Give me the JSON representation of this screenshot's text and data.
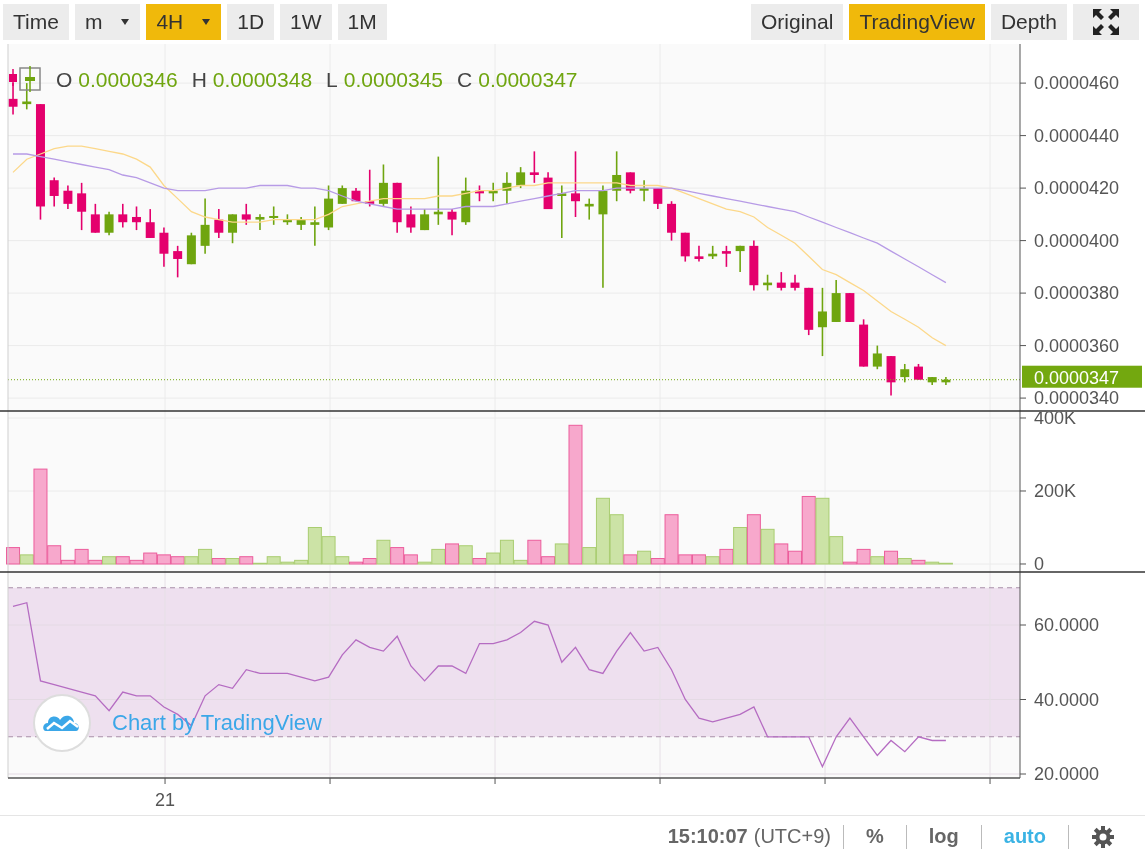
{
  "toolbar": {
    "label": "Time",
    "intervals": [
      {
        "label": "m",
        "dropdown": true,
        "selected": false
      },
      {
        "label": "4H",
        "dropdown": true,
        "selected": true
      },
      {
        "label": "1D",
        "dropdown": false,
        "selected": false
      },
      {
        "label": "1W",
        "dropdown": false,
        "selected": false
      },
      {
        "label": "1M",
        "dropdown": false,
        "selected": false
      }
    ],
    "views": [
      {
        "label": "Original",
        "selected": false
      },
      {
        "label": "TradingView",
        "selected": true
      },
      {
        "label": "Depth",
        "selected": false
      }
    ]
  },
  "price_pane": {
    "legend": [
      {
        "label": "O",
        "value": "0.0000346"
      },
      {
        "label": "H",
        "value": "0.0000348"
      },
      {
        "label": "L",
        "value": "0.0000345"
      },
      {
        "label": "C",
        "value": "0.0000347"
      }
    ],
    "chart_data": {
      "type": "candlestick",
      "grid": true,
      "categories": [
        null,
        null,
        null,
        null,
        null,
        null,
        null,
        null,
        null,
        null,
        null,
        null,
        null,
        null,
        null,
        null,
        null,
        null,
        null,
        null,
        null,
        null,
        null,
        null,
        null,
        null,
        null,
        null,
        null,
        null,
        null,
        null,
        null,
        null,
        null,
        null,
        null,
        null,
        null,
        null,
        null,
        null,
        null,
        null,
        null,
        null,
        null,
        null,
        null,
        null,
        null,
        null,
        null,
        null,
        null,
        null,
        null,
        null,
        null,
        null,
        null,
        null,
        null,
        null,
        null,
        null,
        null,
        null,
        null
      ],
      "ylim": [
        3.347e-05,
        4.749e-05
      ],
      "yticks": [
        {
          "value": 3.4e-05,
          "label": "0.0000340"
        },
        {
          "value": 3.6e-05,
          "label": "0.0000360"
        },
        {
          "value": 3.8e-05,
          "label": "0.0000380"
        },
        {
          "value": 4e-05,
          "label": "0.0000400"
        },
        {
          "value": 4.2e-05,
          "label": "0.0000420"
        },
        {
          "value": 4.4e-05,
          "label": "0.0000440"
        },
        {
          "value": 4.6e-05,
          "label": "0.0000460"
        }
      ],
      "ohlc": [
        [
          4.54e-05,
          4.6e-05,
          4.48e-05,
          4.51e-05
        ],
        [
          4.52e-05,
          4.6e-05,
          4.5e-05,
          4.53e-05
        ],
        [
          4.52e-05,
          4.52e-05,
          4.08e-05,
          4.13e-05
        ],
        [
          4.23e-05,
          4.24e-05,
          4.13e-05,
          4.17e-05
        ],
        [
          4.19e-05,
          4.21e-05,
          4.12e-05,
          4.14e-05
        ],
        [
          4.18e-05,
          4.22e-05,
          4.04e-05,
          4.11e-05
        ],
        [
          4.1e-05,
          4.14e-05,
          4.03e-05,
          4.03e-05
        ],
        [
          4.03e-05,
          4.11e-05,
          4.02e-05,
          4.1e-05
        ],
        [
          4.1e-05,
          4.14e-05,
          4.05e-05,
          4.07e-05
        ],
        [
          4.09e-05,
          4.13e-05,
          4.04e-05,
          4.07e-05
        ],
        [
          4.07e-05,
          4.12e-05,
          4.01e-05,
          4.01e-05
        ],
        [
          4.03e-05,
          4.05e-05,
          3.9e-05,
          3.95e-05
        ],
        [
          3.96e-05,
          3.98e-05,
          3.86e-05,
          3.93e-05
        ],
        [
          3.91e-05,
          4.03e-05,
          3.91e-05,
          4.02e-05
        ],
        [
          3.98e-05,
          4.16e-05,
          3.95e-05,
          4.06e-05
        ],
        [
          4.08e-05,
          4.12e-05,
          4.01e-05,
          4.03e-05
        ],
        [
          4.03e-05,
          4.1e-05,
          3.99e-05,
          4.1e-05
        ],
        [
          4.1e-05,
          4.14e-05,
          4.06e-05,
          4.08e-05
        ],
        [
          4.08e-05,
          4.1e-05,
          4.04e-05,
          4.09e-05
        ],
        [
          4.09e-05,
          4.13e-05,
          4.06e-05,
          4.09e-05
        ],
        [
          4.07e-05,
          4.1e-05,
          4.06e-05,
          4.08e-05
        ],
        [
          4.06e-05,
          4.09e-05,
          4.04e-05,
          4.08e-05
        ],
        [
          4.06e-05,
          4.13e-05,
          3.98e-05,
          4.07e-05
        ],
        [
          4.05e-05,
          4.21e-05,
          4.04e-05,
          4.16e-05
        ],
        [
          4.14e-05,
          4.21e-05,
          4.14e-05,
          4.2e-05
        ],
        [
          4.19e-05,
          4.2e-05,
          4.15e-05,
          4.15e-05
        ],
        [
          4.15e-05,
          4.27e-05,
          4.13e-05,
          4.14e-05
        ],
        [
          4.14e-05,
          4.29e-05,
          4.13e-05,
          4.22e-05
        ],
        [
          4.22e-05,
          4.22e-05,
          4.03e-05,
          4.07e-05
        ],
        [
          4.1e-05,
          4.13e-05,
          4.03e-05,
          4.05e-05
        ],
        [
          4.04e-05,
          4.12e-05,
          4.04e-05,
          4.1e-05
        ],
        [
          4.1e-05,
          4.32e-05,
          4.06e-05,
          4.11e-05
        ],
        [
          4.11e-05,
          4.12e-05,
          4.02e-05,
          4.08e-05
        ],
        [
          4.07e-05,
          4.24e-05,
          4.06e-05,
          4.19e-05
        ],
        [
          4.19e-05,
          4.21e-05,
          4.15e-05,
          4.18e-05
        ],
        [
          4.18e-05,
          4.22e-05,
          4.15e-05,
          4.19e-05
        ],
        [
          4.19e-05,
          4.26e-05,
          4.14e-05,
          4.22e-05
        ],
        [
          4.21e-05,
          4.28e-05,
          4.2e-05,
          4.26e-05
        ],
        [
          4.26e-05,
          4.34e-05,
          4.22e-05,
          4.25e-05
        ],
        [
          4.24e-05,
          4.26e-05,
          4.12e-05,
          4.12e-05
        ],
        [
          4.17e-05,
          4.21e-05,
          4.01e-05,
          4.18e-05
        ],
        [
          4.18e-05,
          4.34e-05,
          4.09e-05,
          4.15e-05
        ],
        [
          4.13e-05,
          4.16e-05,
          4.08e-05,
          4.14e-05
        ],
        [
          4.1e-05,
          4.21e-05,
          3.82e-05,
          4.19e-05
        ],
        [
          4.19e-05,
          4.34e-05,
          4.15e-05,
          4.25e-05
        ],
        [
          4.26e-05,
          4.26e-05,
          4.18e-05,
          4.19e-05
        ],
        [
          4.19e-05,
          4.23e-05,
          4.15e-05,
          4.2e-05
        ],
        [
          4.2e-05,
          4.2e-05,
          4.12e-05,
          4.14e-05
        ],
        [
          4.14e-05,
          4.15e-05,
          4e-05,
          4.03e-05
        ],
        [
          4.03e-05,
          4.03e-05,
          3.92e-05,
          3.94e-05
        ],
        [
          3.94e-05,
          3.98e-05,
          3.92e-05,
          3.93e-05
        ],
        [
          3.94e-05,
          3.98e-05,
          3.93e-05,
          3.95e-05
        ],
        [
          3.96e-05,
          3.98e-05,
          3.9e-05,
          3.95e-05
        ],
        [
          3.96e-05,
          3.98e-05,
          3.88e-05,
          3.98e-05
        ],
        [
          3.98e-05,
          4e-05,
          3.81e-05,
          3.83e-05
        ],
        [
          3.83e-05,
          3.87e-05,
          3.81e-05,
          3.84e-05
        ],
        [
          3.84e-05,
          3.88e-05,
          3.81e-05,
          3.82e-05
        ],
        [
          3.84e-05,
          3.87e-05,
          3.81e-05,
          3.82e-05
        ],
        [
          3.82e-05,
          3.82e-05,
          3.64e-05,
          3.66e-05
        ],
        [
          3.67e-05,
          3.82e-05,
          3.56e-05,
          3.73e-05
        ],
        [
          3.69e-05,
          3.85e-05,
          3.69e-05,
          3.8e-05
        ],
        [
          3.8e-05,
          3.8e-05,
          3.69e-05,
          3.69e-05
        ],
        [
          3.68e-05,
          3.7e-05,
          3.52e-05,
          3.52e-05
        ],
        [
          3.52e-05,
          3.6e-05,
          3.51e-05,
          3.57e-05
        ],
        [
          3.56e-05,
          3.56e-05,
          3.41e-05,
          3.46e-05
        ],
        [
          3.48e-05,
          3.53e-05,
          3.46e-05,
          3.51e-05
        ],
        [
          3.52e-05,
          3.53e-05,
          3.47e-05,
          3.47e-05
        ],
        [
          3.46e-05,
          3.48e-05,
          3.45e-05,
          3.48e-05
        ],
        [
          3.46e-05,
          3.48e-05,
          3.45e-05,
          3.47e-05
        ]
      ],
      "series": [
        {
          "type": "line",
          "color": "#fcd88a",
          "values": [
            4.26e-05,
            4.31e-05,
            4.33e-05,
            4.35e-05,
            4.36e-05,
            4.36e-05,
            4.35e-05,
            4.34e-05,
            4.33e-05,
            4.31e-05,
            4.28e-05,
            4.21e-05,
            4.16e-05,
            4.11e-05,
            4.09e-05,
            4.08e-05,
            4.07e-05,
            4.07e-05,
            4.07e-05,
            4.08e-05,
            4.08e-05,
            4.08e-05,
            4.08e-05,
            4.1e-05,
            4.13e-05,
            4.14e-05,
            4.15e-05,
            4.16e-05,
            4.16e-05,
            4.16e-05,
            4.16e-05,
            4.17e-05,
            4.17e-05,
            4.18e-05,
            4.19e-05,
            4.19e-05,
            4.2e-05,
            4.21e-05,
            4.21e-05,
            4.22e-05,
            4.22e-05,
            4.22e-05,
            4.22e-05,
            4.22e-05,
            4.22e-05,
            4.21e-05,
            4.21e-05,
            4.21e-05,
            4.2e-05,
            4.18e-05,
            4.16e-05,
            4.14e-05,
            4.12e-05,
            4.11e-05,
            4.09e-05,
            4.05e-05,
            4.02e-05,
            3.99e-05,
            3.94e-05,
            3.89e-05,
            3.87e-05,
            3.84e-05,
            3.81e-05,
            3.77e-05,
            3.73e-05,
            3.7e-05,
            3.67e-05,
            3.63e-05,
            3.6e-05
          ]
        },
        {
          "type": "line",
          "color": "#b79be6",
          "values": [
            4.33e-05,
            4.33e-05,
            4.32e-05,
            4.31e-05,
            4.3e-05,
            4.29e-05,
            4.28e-05,
            4.27e-05,
            4.25e-05,
            4.24e-05,
            4.22e-05,
            4.2e-05,
            4.19e-05,
            4.19e-05,
            4.19e-05,
            4.2e-05,
            4.2e-05,
            4.2e-05,
            4.21e-05,
            4.21e-05,
            4.21e-05,
            4.2e-05,
            4.2e-05,
            4.19e-05,
            4.17e-05,
            4.15e-05,
            4.14e-05,
            4.13e-05,
            4.12e-05,
            4.12e-05,
            4.12e-05,
            4.12e-05,
            4.12e-05,
            4.13e-05,
            4.13e-05,
            4.13e-05,
            4.14e-05,
            4.15e-05,
            4.16e-05,
            4.17e-05,
            4.18e-05,
            4.19e-05,
            4.19e-05,
            4.19e-05,
            4.2e-05,
            4.2e-05,
            4.2e-05,
            4.2e-05,
            4.2e-05,
            4.19e-05,
            4.18e-05,
            4.17e-05,
            4.16e-05,
            4.15e-05,
            4.14e-05,
            4.13e-05,
            4.12e-05,
            4.11e-05,
            4.09e-05,
            4.07e-05,
            4.05e-05,
            4.03e-05,
            4.01e-05,
            3.99e-05,
            3.96e-05,
            3.93e-05,
            3.9e-05,
            3.87e-05,
            3.84e-05
          ]
        }
      ],
      "ref_lines": [
        {
          "axis": "y",
          "value": 3.47e-05,
          "label": "0.0000347",
          "color": "#73a80f"
        }
      ]
    }
  },
  "volume_pane": {
    "chart_data": {
      "type": "bar",
      "grid": true,
      "categories": [
        null,
        null,
        null,
        null,
        null,
        null,
        null,
        null,
        null,
        null,
        null,
        null,
        null,
        null,
        null,
        null,
        null,
        null,
        null,
        null,
        null,
        null,
        null,
        null,
        null,
        null,
        null,
        null,
        null,
        null,
        null,
        null,
        null,
        null,
        null,
        null,
        null,
        null,
        null,
        null,
        null,
        null,
        null,
        null,
        null,
        null,
        null,
        null,
        null,
        null,
        null,
        null,
        null,
        null,
        null,
        null,
        null,
        null,
        null,
        null,
        null,
        null,
        null,
        null,
        null,
        null,
        null,
        null,
        null
      ],
      "ylim": [
        -24658,
        416438
      ],
      "yticks": [
        {
          "value": 0,
          "label": "0"
        },
        {
          "value": 200000,
          "label": "200K"
        },
        {
          "value": 400000,
          "label": "400K"
        }
      ],
      "series": [
        {
          "values": [
            45000,
            25000,
            260000,
            50000,
            10000,
            40000,
            10000,
            20000,
            20000,
            10000,
            30000,
            25000,
            20000,
            20000,
            40000,
            15000,
            15000,
            20000,
            2000,
            20000,
            5000,
            10000,
            100000,
            75000,
            20000,
            5000,
            15000,
            65000,
            45000,
            25000,
            5000,
            40000,
            55000,
            50000,
            15000,
            30000,
            65000,
            10000,
            65000,
            20000,
            55000,
            380000,
            45000,
            180000,
            135000,
            25000,
            35000,
            15000,
            135000,
            25000,
            25000,
            20000,
            40000,
            100000,
            135000,
            95000,
            55000,
            35000,
            185000,
            180000,
            75000,
            5000,
            40000,
            20000,
            35000,
            15000,
            10000,
            5000,
            2000
          ]
        }
      ]
    }
  },
  "rsi_pane": {
    "chart_data": {
      "type": "line",
      "grid": true,
      "categories": [
        null,
        null,
        null,
        null,
        null,
        null,
        null,
        null,
        null,
        null,
        null,
        "21",
        null,
        null,
        null,
        null,
        null,
        null,
        null,
        null,
        null,
        null,
        null,
        null,
        null,
        null,
        null,
        null,
        null,
        null,
        null,
        null,
        null,
        null,
        null,
        null,
        null,
        null,
        null,
        null,
        null,
        null,
        null,
        null,
        null,
        null,
        null,
        null,
        null,
        null,
        null,
        null,
        null,
        null,
        null,
        null,
        null,
        null,
        null,
        null,
        null,
        null,
        null,
        null,
        null,
        null,
        null,
        null,
        null
      ],
      "ylim": [
        18.93,
        73.96
      ],
      "yticks": [
        {
          "value": 20,
          "label": "20.0000"
        },
        {
          "value": 40,
          "label": "40.0000"
        },
        {
          "value": 60,
          "label": "60.0000"
        }
      ],
      "bands": [
        {
          "axis": "y",
          "from": 30,
          "to": 70
        }
      ],
      "ref_lines": [
        {
          "axis": "y",
          "value": 70
        },
        {
          "axis": "y",
          "value": 30
        }
      ],
      "series": [
        {
          "color": "#b56cc2",
          "values": [
            65,
            66,
            45,
            44,
            43,
            42,
            41,
            37,
            42,
            41,
            41,
            38,
            36,
            33,
            41,
            44,
            43,
            48,
            47,
            47,
            47,
            46,
            45,
            46,
            52,
            56,
            54,
            53,
            57,
            49,
            45,
            49,
            49,
            47,
            55,
            55,
            56,
            58,
            61,
            60,
            50,
            54,
            48,
            47,
            53,
            58,
            53,
            54,
            48,
            40,
            35,
            34,
            35,
            36,
            38,
            30,
            30,
            30,
            30,
            22,
            30,
            35,
            30,
            25,
            29,
            26,
            30,
            29,
            29
          ]
        }
      ]
    },
    "watermark_link": "Chart by TradingView"
  },
  "status_bar": {
    "time": "15:10:07",
    "timezone": "(UTC+9)",
    "options": [
      {
        "label": "%",
        "active": false
      },
      {
        "label": "log",
        "active": false
      },
      {
        "label": "auto",
        "active": true
      }
    ]
  }
}
